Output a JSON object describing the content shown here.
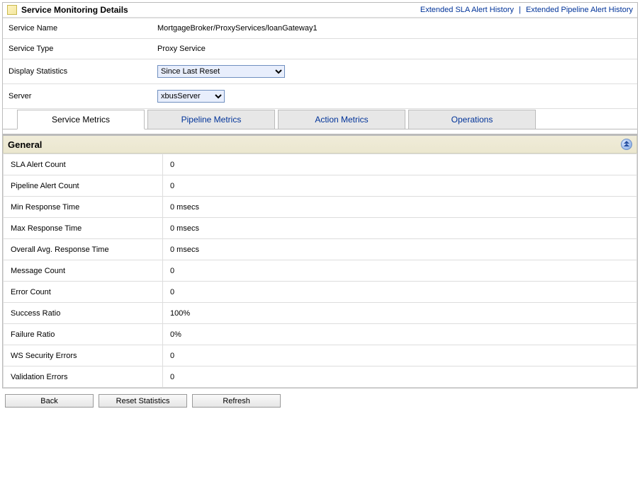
{
  "header": {
    "title": "Service Monitoring Details",
    "link_sla": "Extended SLA Alert History",
    "link_pipeline": "Extended Pipeline Alert History"
  },
  "details": {
    "service_name_label": "Service Name",
    "service_name_value": "MortgageBroker/ProxyServices/loanGateway1",
    "service_type_label": "Service Type",
    "service_type_value": "Proxy Service",
    "display_stats_label": "Display Statistics",
    "display_stats_value": "Since Last Reset",
    "server_label": "Server",
    "server_value": "xbusServer"
  },
  "tabs": {
    "service_metrics": "Service Metrics",
    "pipeline_metrics": "Pipeline Metrics",
    "action_metrics": "Action Metrics",
    "operations": "Operations"
  },
  "general": {
    "heading": "General",
    "rows": [
      {
        "label": "SLA Alert Count",
        "value": "0"
      },
      {
        "label": "Pipeline Alert Count",
        "value": "0"
      },
      {
        "label": "Min Response Time",
        "value": "0 msecs"
      },
      {
        "label": "Max Response Time",
        "value": "0 msecs"
      },
      {
        "label": "Overall Avg. Response Time",
        "value": "0 msecs"
      },
      {
        "label": "Message Count",
        "value": "0"
      },
      {
        "label": "Error Count",
        "value": "0"
      },
      {
        "label": "Success Ratio",
        "value": "100%"
      },
      {
        "label": "Failure Ratio",
        "value": "0%"
      },
      {
        "label": "WS Security Errors",
        "value": "0"
      },
      {
        "label": "Validation Errors",
        "value": "0"
      }
    ]
  },
  "buttons": {
    "back": "Back",
    "reset": "Reset Statistics",
    "refresh": "Refresh"
  }
}
